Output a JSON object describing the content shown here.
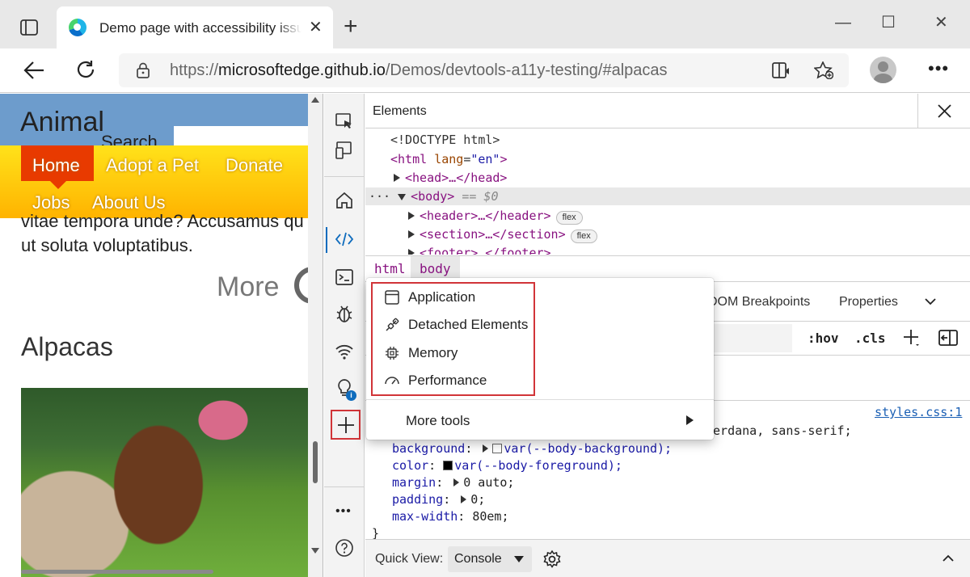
{
  "browser": {
    "tab_title": "Demo page with accessibility issues",
    "url_prefix": "https://",
    "url_host": "microsoftedge.github.io",
    "url_path": "/Demos/devtools-a11y-testing/#alpacas"
  },
  "webpage": {
    "logo": "Animal",
    "search_label": "Search",
    "nav": [
      "Home",
      "Adopt a Pet",
      "Donate",
      "Jobs",
      "About Us"
    ],
    "body_line1": "vitae tempora unde? Accusamus qu",
    "body_line2": "ut soluta voluptatibus.",
    "more": "More",
    "heading": "Alpacas"
  },
  "devtools": {
    "panel_title": "Elements",
    "dom": {
      "doctype": "<!DOCTYPE html>",
      "html_open": "<html",
      "lang_attr": "lang",
      "lang_val": "\"en\"",
      "head": "<head>…</head>",
      "body": "<body>",
      "body_ref": "== $0",
      "header": "<header>…</header>",
      "section": "<section>…</section>",
      "footer": "<footer>…</footer>",
      "flex": "flex"
    },
    "breadcrumbs": [
      "html",
      "body"
    ],
    "subtabs": [
      "DOM Breakpoints",
      "Properties"
    ],
    "filter_buttons": [
      ":hov",
      ".cls"
    ],
    "styles_source": "styles.css:1",
    "font_tail": "Verdana, sans-serif;",
    "styles": [
      {
        "prop": "background",
        "value": "var(--body-background);",
        "swatch": "#ffffff"
      },
      {
        "prop": "color",
        "value": "var(--body-foreground);",
        "swatch": "#000000"
      },
      {
        "prop": "margin",
        "value": "0 auto;"
      },
      {
        "prop": "padding",
        "value": "0;"
      },
      {
        "prop": "max-width",
        "value": "80em;"
      }
    ],
    "closing_brace": "}",
    "quick_view_label": "Quick View:",
    "quick_view_value": "Console"
  },
  "context_menu": {
    "items": [
      "Application",
      "Detached Elements",
      "Memory",
      "Performance"
    ],
    "more_tools": "More tools"
  },
  "colors": {
    "accent": "#0f6cbd",
    "highlight_border": "#d13438",
    "page_header": "#6d9ccc",
    "nav_gradient_top": "#ffe21a",
    "nav_active": "#e83a00"
  }
}
